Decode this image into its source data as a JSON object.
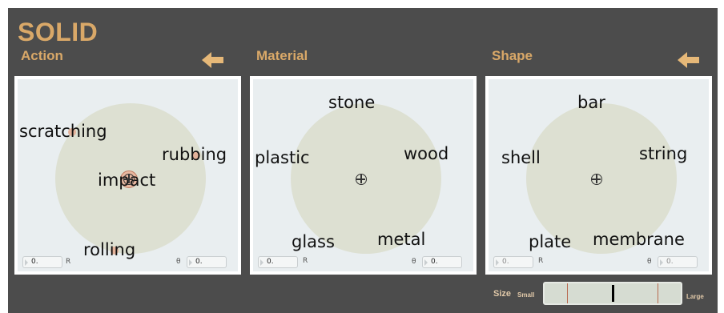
{
  "title": "SOLID",
  "accent_color": "#d9a868",
  "sections": {
    "action": {
      "label": "Action",
      "words": [
        "scratching",
        "rubbing",
        "impact",
        "rolling"
      ],
      "r_value": "0.",
      "r_label": "R",
      "theta_label": "θ",
      "theta_value": "0.",
      "back_icon": "left-arrow-icon"
    },
    "material": {
      "label": "Material",
      "words": [
        "stone",
        "plastic",
        "wood",
        "glass",
        "metal"
      ],
      "r_value": "0.",
      "r_label": "R",
      "theta_label": "θ",
      "theta_value": "0."
    },
    "shape": {
      "label": "Shape",
      "words": [
        "bar",
        "shell",
        "string",
        "plate",
        "membrane"
      ],
      "r_value": "0.",
      "r_label": "R",
      "theta_label": "θ",
      "theta_value": "0.",
      "back_icon": "left-arrow-icon"
    }
  },
  "size": {
    "label": "Size",
    "small_label": "Small",
    "large_label": "Large",
    "value": 0.5
  }
}
